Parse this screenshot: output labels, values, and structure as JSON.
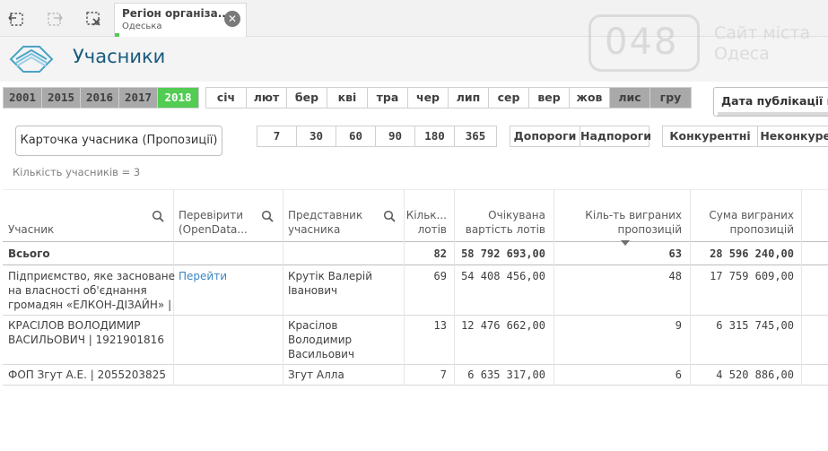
{
  "toolbar": {
    "selection_tab": {
      "title": "Регіон організа...",
      "value": "Одеська"
    }
  },
  "watermark": {
    "number": "048",
    "line1": "Сайт міста",
    "line2": "Одеса"
  },
  "sheet": {
    "title": "Учасники"
  },
  "years": [
    {
      "label": "2001",
      "state": "gray"
    },
    {
      "label": "2015",
      "state": "gray"
    },
    {
      "label": "2016",
      "state": "gray"
    },
    {
      "label": "2017",
      "state": "gray"
    },
    {
      "label": "2018",
      "state": "selected"
    }
  ],
  "months": [
    {
      "label": "січ",
      "state": "normal"
    },
    {
      "label": "лют",
      "state": "normal"
    },
    {
      "label": "бер",
      "state": "normal"
    },
    {
      "label": "кві",
      "state": "normal"
    },
    {
      "label": "тра",
      "state": "normal"
    },
    {
      "label": "чер",
      "state": "normal"
    },
    {
      "label": "лип",
      "state": "normal"
    },
    {
      "label": "сер",
      "state": "normal"
    },
    {
      "label": "вер",
      "state": "normal"
    },
    {
      "label": "жов",
      "state": "normal"
    },
    {
      "label": "лис",
      "state": "gray"
    },
    {
      "label": "гру",
      "state": "gray"
    }
  ],
  "date_filter": {
    "label": "Дата публікації проп"
  },
  "card_button": {
    "label": "Карточка учасника (Пропозиції)"
  },
  "days": [
    "7",
    "30",
    "60",
    "90",
    "180",
    "365"
  ],
  "thresholds": [
    "Допороги",
    "Надпороги"
  ],
  "competition": [
    "Конкурентні",
    "Неконкурен"
  ],
  "participants_count": "Кількість учасників = 3",
  "table": {
    "columns": {
      "participant": "Учасник",
      "check_line1": "Перевірити",
      "check_line2": "(OpenData...",
      "rep_line1": "Представник",
      "rep_line2": "учасника",
      "lots_line1": "Кільк...",
      "lots_line2": "лотів",
      "expected_line1": "Очікувана",
      "expected_line2": "вартість лотів",
      "won_line1": "Кіль-ть виграних",
      "won_line2": "пропозицій",
      "sum_line1": "Сума виграних",
      "sum_line2": "пропозицій"
    },
    "totals": {
      "label": "Всього",
      "lots": "82",
      "expected": "58 792 693,00",
      "won": "63",
      "sum": "28 596 240,00"
    },
    "rows": [
      {
        "participant_lines": [
          "Підприємство, яке засноване",
          "на власності об'єднання",
          "громадян «ЕЛКОН-ДІЗАЙН» |"
        ],
        "check": "Перейти",
        "rep_lines": [
          "Крутік Валерій",
          "Іванович"
        ],
        "lots": "69",
        "expected": "54 408 456,00",
        "won": "48",
        "sum": "17 759 609,00"
      },
      {
        "participant_lines": [
          "КРАСІЛОВ ВОЛОДИМИР",
          "ВАСИЛЬОВИЧ | 1921901816"
        ],
        "check": "",
        "rep_lines": [
          "Красілов",
          "Володимир",
          "Васильович"
        ],
        "lots": "13",
        "expected": "12 476 662,00",
        "won": "9",
        "sum": "6 315 745,00"
      },
      {
        "participant_lines": [
          "ФОП Згут А.Е. | 2055203825"
        ],
        "check": "",
        "rep_lines": [
          "Згут Алла"
        ],
        "lots": "7",
        "expected": "6 635 317,00",
        "won": "6",
        "sum": "4 520 886,00"
      }
    ]
  },
  "colors": {
    "selected_green": "#52cc52",
    "excluded_gray": "#a9a9a9",
    "title_blue": "#185a7d",
    "link_blue": "#3b86c2"
  },
  "icons": [
    "back-icon",
    "forward-icon",
    "clear-selections-icon",
    "close-icon",
    "search-icon",
    "sort-descending-icon"
  ]
}
